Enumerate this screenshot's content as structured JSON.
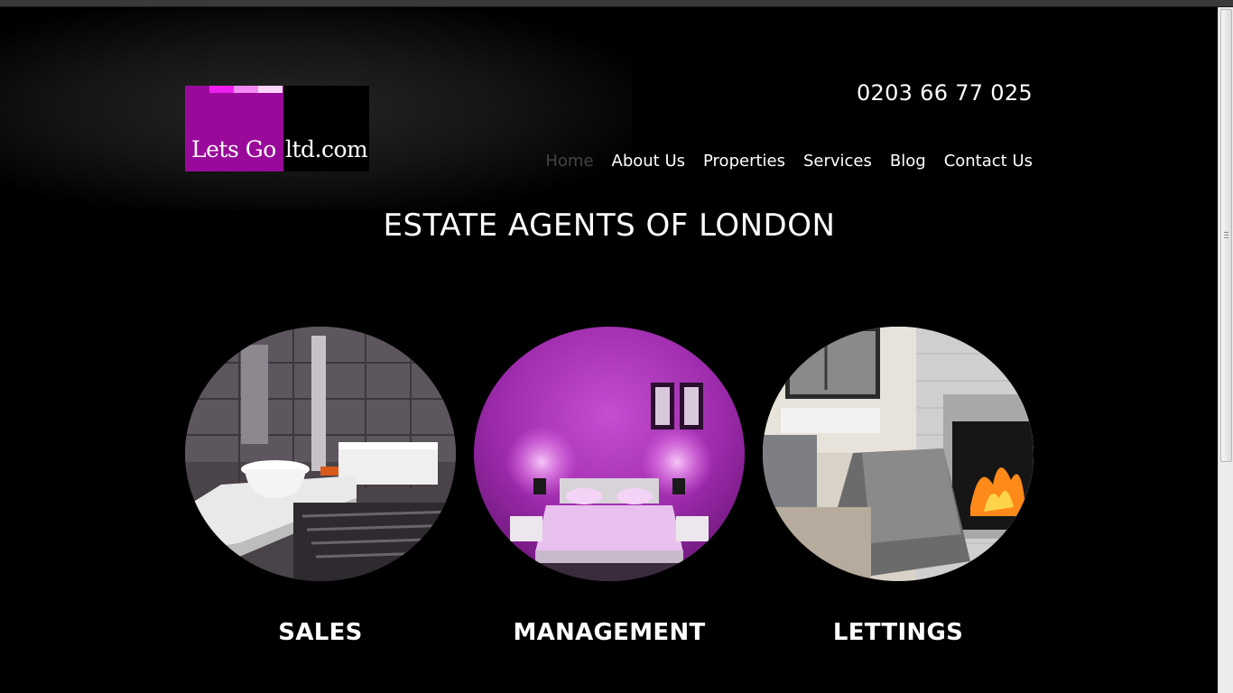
{
  "header": {
    "logo_text_left": "Lets Go",
    "logo_text_right": "ltd.com",
    "phone": "0203 66 77 025"
  },
  "nav": {
    "items": [
      {
        "label": "Home",
        "active": true
      },
      {
        "label": "About Us"
      },
      {
        "label": "Properties"
      },
      {
        "label": "Services"
      },
      {
        "label": "Blog"
      },
      {
        "label": "Contact Us"
      }
    ]
  },
  "main": {
    "headline": "ESTATE AGENTS OF LONDON",
    "services": [
      {
        "label": "SALES",
        "image": "bathroom-photo"
      },
      {
        "label": "MANAGEMENT",
        "image": "purple-bedroom-photo"
      },
      {
        "label": "LETTINGS",
        "image": "fireplace-living-room-photo"
      }
    ]
  },
  "colors": {
    "background": "#000000",
    "brand_purple": "#9a0a9a",
    "nav_active": "#444444"
  }
}
